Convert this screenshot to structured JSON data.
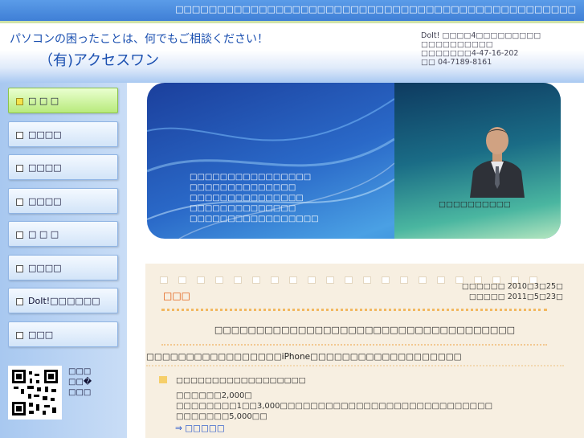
{
  "topbar": {
    "text": "□□□□□□□□□□□□□□□□□□□□□□□□□□□□□□□□□□□□□□□□□□□□□□□□"
  },
  "header": {
    "tagline": "パソコンの困ったことは、何でもご相談ください！",
    "company": "（有)アクセスワン",
    "contact": {
      "line1": "DoIt! □□□□4□□□□□□□□□",
      "line2": "□□□□□□□□□□",
      "line3": "□□□□□□□4-47-16-202",
      "line4": "□□ 04-7189-8161"
    }
  },
  "sidebar": {
    "items": [
      {
        "label": "□ □ □"
      },
      {
        "label": "□□□□"
      },
      {
        "label": "□□□□"
      },
      {
        "label": "□□□□"
      },
      {
        "label": "□ □ □"
      },
      {
        "label": "□□□□"
      },
      {
        "label": "DoIt!□□□□□□"
      },
      {
        "label": "□□□"
      }
    ],
    "qr_text": {
      "line1": "□□□",
      "line2": "□□�",
      "line3": "□□□"
    }
  },
  "banner": {
    "lines": [
      "□□□□□□□□□□□□□□□□",
      "□□□□□□□□□□□□□□",
      "□□□□□□□□□□□□□□□",
      "□□□□□□□□□□□□□□",
      "□□□□□□□□□□□□□□□□□"
    ],
    "caption": "□□□□□□□□□□"
  },
  "content": {
    "section_title": "□□□",
    "created": "□□□□□□ 2010□3□25□",
    "updated": "□□□□□ 2011□5□23□",
    "heading": "□□□□□□□□□□□□□□□□□□□□□□□□□□□□□□□□□□□□",
    "intro": "□□□□□□□□□□□□□□□□□iPhone□□□□□□□□□□□□□□□□□□□",
    "service_title": "□□□□□□□□□□□□□□□□□□",
    "price_lines": [
      "□□□□□□2,000□",
      "□□□□□□□□1□□3,000□□□□□□□□□□□□□□□□□□□□□□□□□□□□",
      "□□□□□□□5,000□□"
    ],
    "more_link": "⇒ □□□□□"
  }
}
